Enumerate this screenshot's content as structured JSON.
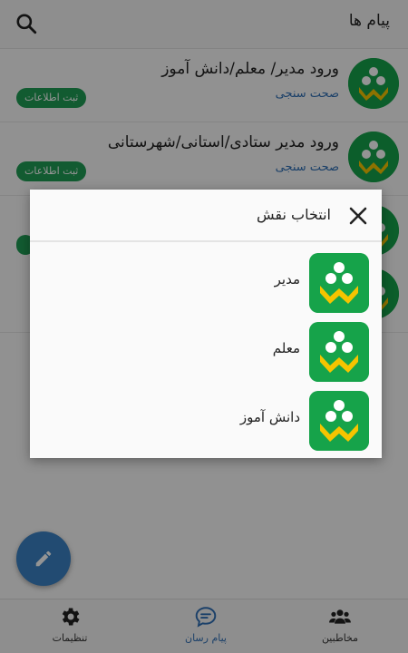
{
  "appbar": {
    "title": "پیام ها",
    "search_icon": "search-icon"
  },
  "list": [
    {
      "title": "ورود مدیر/ معلم/دانش آموز",
      "subtitle": "صحت سنجی",
      "badge": "ثبت اطلاعات"
    },
    {
      "title": "ورود مدیر ستادی/استانی/شهرستانی",
      "subtitle": "صحت سنجی",
      "badge": "ثبت اطلاعات"
    },
    {
      "title": "",
      "subtitle": "",
      "badge": ""
    },
    {
      "title": "",
      "subtitle": "",
      "badge": ""
    }
  ],
  "dialog": {
    "title": "انتخاب نقش",
    "roles": [
      {
        "label": "مدیر"
      },
      {
        "label": "معلم"
      },
      {
        "label": "دانش آموز"
      }
    ]
  },
  "bottomnav": {
    "items": [
      {
        "label": "تنظیمات",
        "icon": "gear-icon"
      },
      {
        "label": "پیام رسان",
        "icon": "chat-icon"
      },
      {
        "label": "مخاطبین",
        "icon": "contacts-icon"
      }
    ]
  },
  "colors": {
    "brand_green": "#16a34a",
    "brand_yellow": "#f5c400",
    "accent_blue": "#2f6fb5",
    "badge_green": "#1f9d55"
  }
}
